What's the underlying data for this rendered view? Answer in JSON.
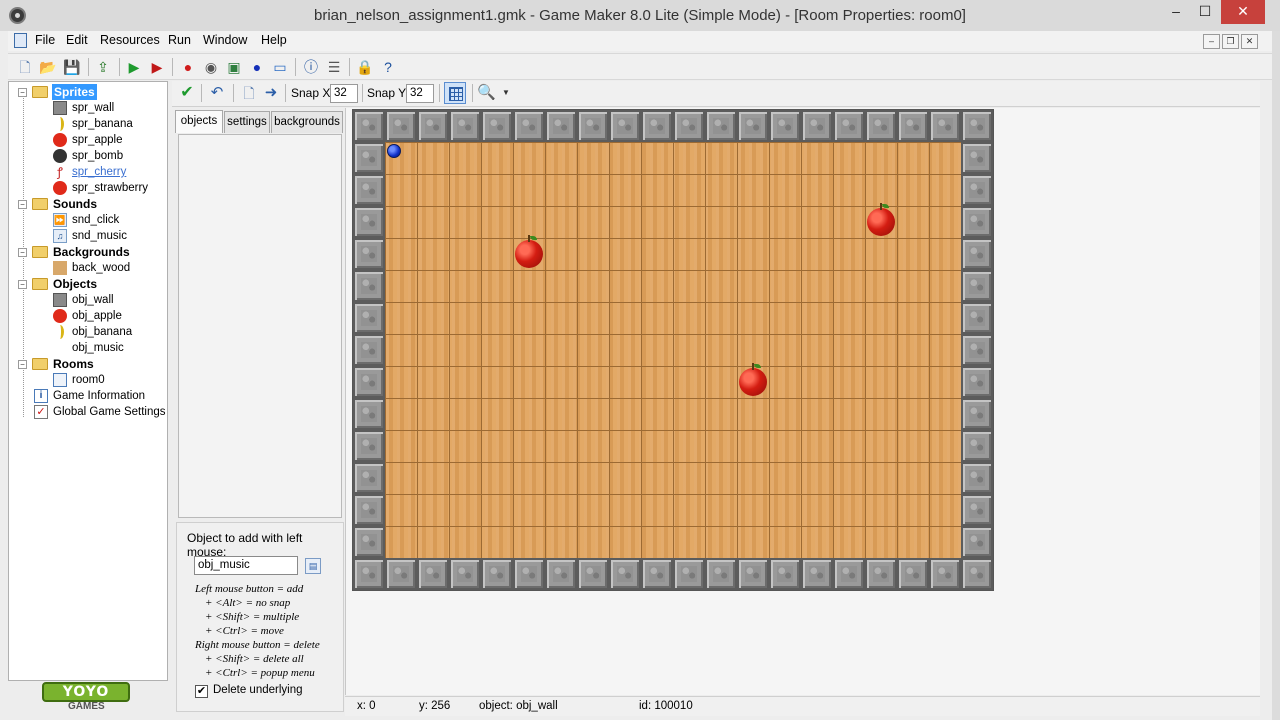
{
  "window": {
    "title": "brian_nelson_assignment1.gmk - Game Maker 8.0 Lite (Simple Mode) - [Room Properties: room0]",
    "min_label": "–",
    "max_label": "☐",
    "close_label": "✕"
  },
  "menu": {
    "items": [
      "File",
      "Edit",
      "Resources",
      "Run",
      "Window",
      "Help"
    ]
  },
  "tree": {
    "sprites": {
      "label": "Sprites",
      "items": [
        "spr_wall",
        "spr_banana",
        "spr_apple",
        "spr_bomb",
        "spr_cherry",
        "spr_strawberry"
      ]
    },
    "sounds": {
      "label": "Sounds",
      "items": [
        "snd_click",
        "snd_music"
      ]
    },
    "backgrounds": {
      "label": "Backgrounds",
      "items": [
        "back_wood"
      ]
    },
    "objects": {
      "label": "Objects",
      "items": [
        "obj_wall",
        "obj_apple",
        "obj_banana",
        "obj_music"
      ]
    },
    "rooms": {
      "label": "Rooms",
      "items": [
        "room0"
      ]
    },
    "game_information": "Game Information",
    "global_game_settings": "Global Game Settings"
  },
  "logo": {
    "brand": "YOYO",
    "sub": "GAMES"
  },
  "room_toolbar": {
    "snap_x_label": "Snap X:",
    "snap_x_value": "32",
    "snap_y_label": "Snap Y:",
    "snap_y_value": "32"
  },
  "tabs": [
    "objects",
    "settings",
    "backgrounds"
  ],
  "add_panel": {
    "title": "Object to add with left mouse:",
    "object_value": "obj_music",
    "help": [
      "Left mouse button = add",
      "+ <Alt> = no snap",
      "+ <Shift> = multiple",
      "+ <Ctrl> = move",
      "Right mouse button = delete",
      "+ <Shift> = delete all",
      "+ <Ctrl> = popup menu"
    ],
    "delete_underlying_label": "Delete underlying",
    "delete_underlying_checked": true
  },
  "status": {
    "x": "x: 0",
    "y": "y: 256",
    "object": "object: obj_wall",
    "id": "id: 100010"
  },
  "room": {
    "grid_cols": 20,
    "grid_rows": 15,
    "colors": {
      "floor": "#e0a25c",
      "wall": "#9a9a9a",
      "apple": "#d41d12",
      "music": "#1030c8"
    },
    "apples": [
      {
        "col": 5,
        "row": 4
      },
      {
        "col": 16,
        "row": 3
      },
      {
        "col": 12,
        "row": 8
      }
    ],
    "music": {
      "col": 1,
      "row": 1
    }
  }
}
